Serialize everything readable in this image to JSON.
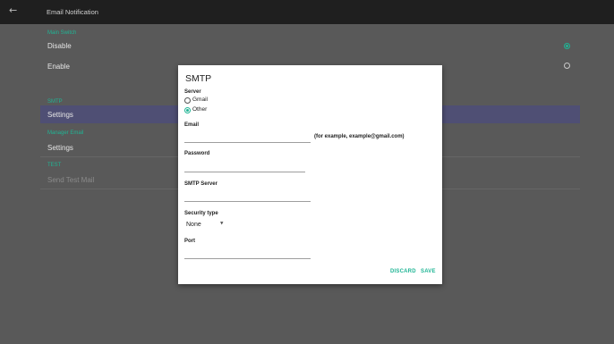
{
  "appbar": {
    "back_icon": "back-arrow-icon",
    "title": "Email Notification"
  },
  "background": {
    "main_switch": {
      "section": "Main Switch",
      "options": [
        {
          "label": "Disable",
          "selected": true
        },
        {
          "label": "Enable",
          "selected": false
        }
      ]
    },
    "smtp": {
      "section": "SMTP",
      "item": "Settings"
    },
    "manager_email": {
      "section": "Manager Email",
      "item": "Settings"
    },
    "test": {
      "section": "TEST",
      "item": "Send Test Mail"
    }
  },
  "dialog": {
    "title": "SMTP",
    "server": {
      "label": "Server",
      "options": [
        {
          "label": "Gmail",
          "selected": false
        },
        {
          "label": "Other",
          "selected": true
        }
      ]
    },
    "email": {
      "label": "Email",
      "value": "",
      "hint": "(for example, example@gmail.com)"
    },
    "password": {
      "label": "Password",
      "value": ""
    },
    "smtp_server": {
      "label": "SMTP Server",
      "value": ""
    },
    "security_type": {
      "label": "Security type",
      "value": "None"
    },
    "port": {
      "label": "Port",
      "value": ""
    },
    "actions": {
      "discard": "DISCARD",
      "save": "SAVE"
    }
  },
  "colors": {
    "accent": "#20b595",
    "selected_row": "#4f4f74",
    "app_bar": "#1f1f1f",
    "dimmed_background": "#595959",
    "dialog_background": "#ffffff"
  }
}
